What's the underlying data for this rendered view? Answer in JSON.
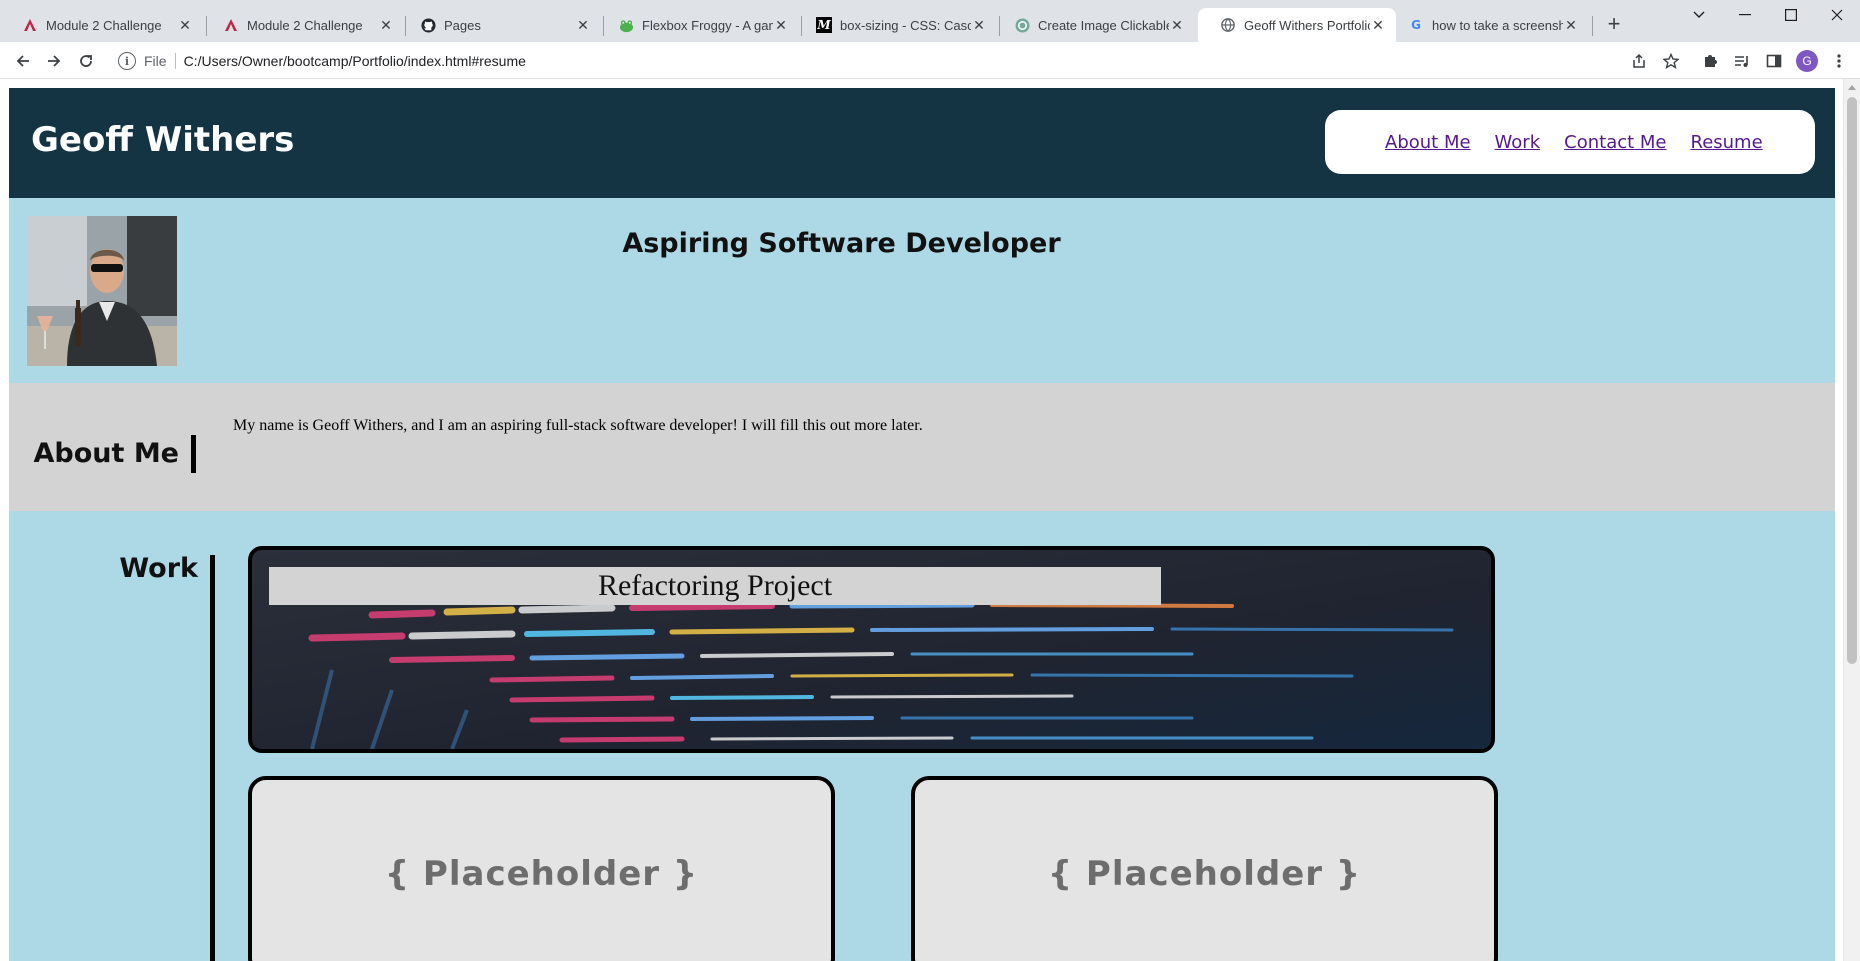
{
  "browser": {
    "tabs": [
      {
        "title": "Module 2 Challenge",
        "icon": "bootcamp-icon"
      },
      {
        "title": "Module 2 Challenge",
        "icon": "bootcamp-icon"
      },
      {
        "title": "Pages",
        "icon": "github-icon"
      },
      {
        "title": "Flexbox Froggy - A game",
        "icon": "frog-icon"
      },
      {
        "title": "box-sizing - CSS: Cascadi",
        "icon": "mdn-icon"
      },
      {
        "title": "Create Image Clickable Li",
        "icon": "chatgpt-icon"
      },
      {
        "title": "Geoff Withers Portfolio",
        "icon": "globe-icon",
        "active": true
      },
      {
        "title": "how to take a screenshot",
        "icon": "google-icon"
      }
    ],
    "address": {
      "scheme_label": "File",
      "url": "C:/Users/Owner/bootcamp/Portfolio/index.html#resume"
    },
    "profile_initial": "G"
  },
  "site": {
    "title": "Geoff Withers",
    "nav": [
      "About Me",
      "Work",
      "Contact Me",
      "Resume"
    ],
    "nav_color": "#551a8b",
    "header_color": "#153443",
    "hero": {
      "heading": "Aspiring Software Developer",
      "bg": "#add8e6"
    },
    "about": {
      "heading": "About Me",
      "text": "My name is Geoff Withers, and I am an aspiring full-stack software developer! I will fill this out more later."
    },
    "work": {
      "heading": "Work",
      "featured": "Refactoring Project",
      "placeholders": [
        "{ Placeholder }",
        "{ Placeholder }"
      ]
    }
  }
}
